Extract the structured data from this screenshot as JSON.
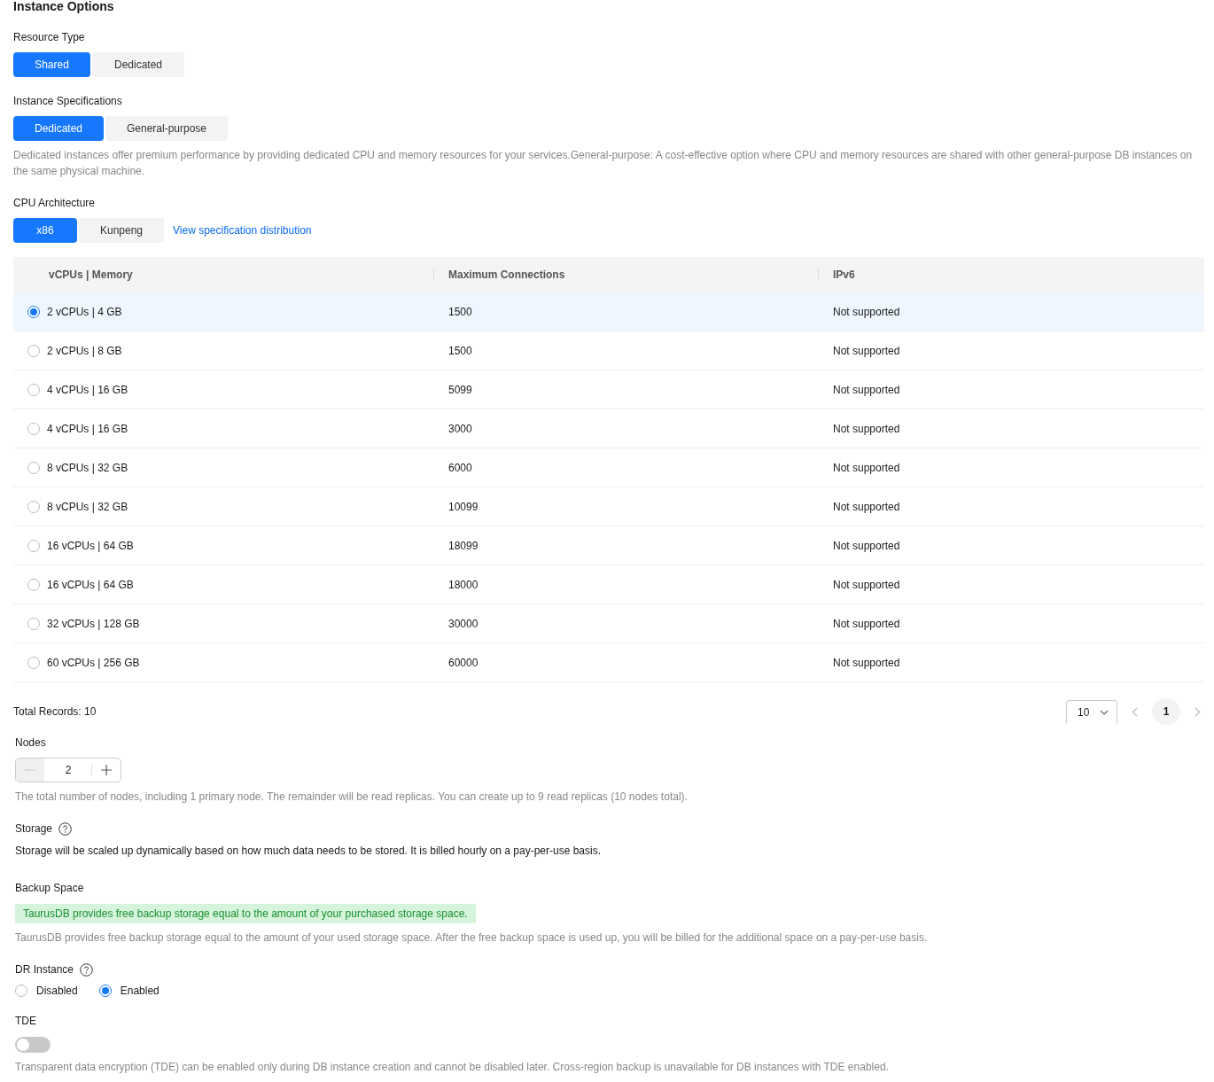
{
  "title": "Instance Options",
  "resource_type": {
    "label": "Resource Type",
    "options": [
      {
        "label": "Shared",
        "selected": true
      },
      {
        "label": "Dedicated",
        "selected": false
      }
    ]
  },
  "instance_specifications": {
    "label": "Instance Specifications",
    "options": [
      {
        "label": "Dedicated",
        "selected": true
      },
      {
        "label": "General-purpose",
        "selected": false
      }
    ],
    "description": "Dedicated instances offer premium performance by providing dedicated CPU and memory resources for your services.General-purpose: A cost-effective option where CPU and memory resources are shared with other general-purpose DB instances on the same physical machine."
  },
  "cpu_architecture": {
    "label": "CPU Architecture",
    "options": [
      {
        "label": "x86",
        "selected": true
      },
      {
        "label": "Kunpeng",
        "selected": false
      }
    ],
    "link": "View specification distribution"
  },
  "table": {
    "columns": [
      "vCPUs | Memory",
      "Maximum Connections",
      "IPv6"
    ],
    "rows": [
      {
        "spec": "2 vCPUs | 4 GB",
        "connections": "1500",
        "ipv6": "Not supported",
        "selected": true
      },
      {
        "spec": "2 vCPUs | 8 GB",
        "connections": "1500",
        "ipv6": "Not supported",
        "selected": false
      },
      {
        "spec": "4 vCPUs | 16 GB",
        "connections": "5099",
        "ipv6": "Not supported",
        "selected": false
      },
      {
        "spec": "4 vCPUs | 16 GB",
        "connections": "3000",
        "ipv6": "Not supported",
        "selected": false
      },
      {
        "spec": "8 vCPUs | 32 GB",
        "connections": "6000",
        "ipv6": "Not supported",
        "selected": false
      },
      {
        "spec": "8 vCPUs | 32 GB",
        "connections": "10099",
        "ipv6": "Not supported",
        "selected": false
      },
      {
        "spec": "16 vCPUs | 64 GB",
        "connections": "18099",
        "ipv6": "Not supported",
        "selected": false
      },
      {
        "spec": "16 vCPUs | 64 GB",
        "connections": "18000",
        "ipv6": "Not supported",
        "selected": false
      },
      {
        "spec": "32 vCPUs | 128 GB",
        "connections": "30000",
        "ipv6": "Not supported",
        "selected": false
      },
      {
        "spec": "60 vCPUs | 256 GB",
        "connections": "60000",
        "ipv6": "Not supported",
        "selected": false
      }
    ]
  },
  "pagination": {
    "total": "Total Records: 10",
    "page_size": "10",
    "pages": [
      {
        "label": "1",
        "selected": true
      }
    ]
  },
  "nodes": {
    "label": "Nodes",
    "value": "2",
    "decrement_disabled": true,
    "description": "The total number of nodes, including 1 primary node. The remainder will be read replicas. You can create up to 9 read replicas (10 nodes total)."
  },
  "storage": {
    "label": "Storage",
    "description": "Storage will be scaled up dynamically based on how much data needs to be stored. It is billed hourly on a pay-per-use basis."
  },
  "backup_space": {
    "label": "Backup Space",
    "notice": "TaurusDB provides free backup storage equal to the amount of your purchased storage space.",
    "description": "TaurusDB provides free backup storage equal to the amount of your used storage space. After the free backup space is used up, you will be billed for the additional space on a pay-per-use basis."
  },
  "dr_instance": {
    "label": "DR Instance",
    "options": [
      {
        "label": "Disabled",
        "selected": false
      },
      {
        "label": "Enabled",
        "selected": true
      }
    ]
  },
  "tde": {
    "label": "TDE",
    "on": false,
    "description": "Transparent data encryption (TDE) can be enabled only during DB instance creation and cannot be disabled later. Cross-region backup is unavailable for DB instances with TDE enabled."
  }
}
